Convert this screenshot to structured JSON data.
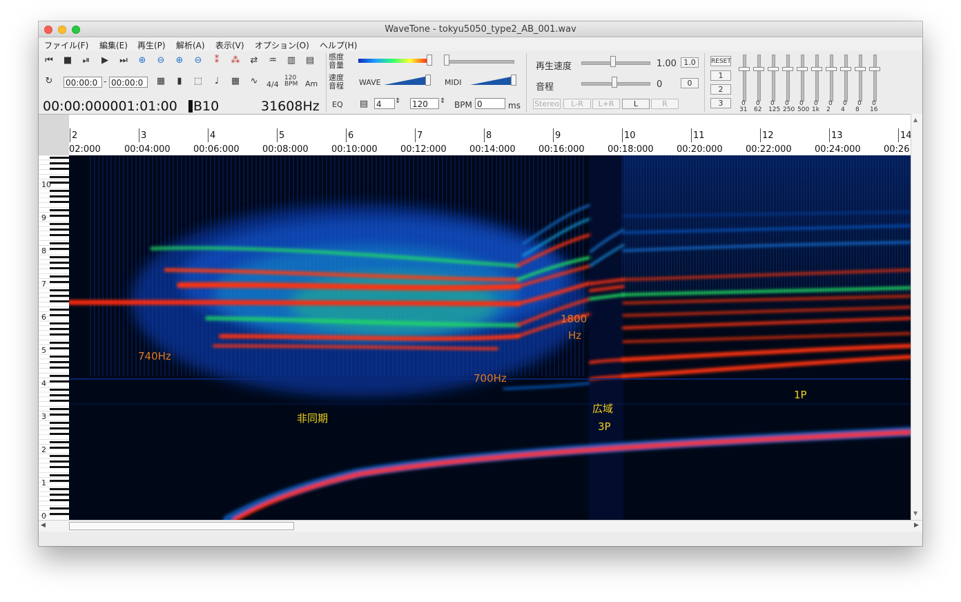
{
  "window": {
    "title": "WaveTone - tokyu5050_type2_AB_001.wav"
  },
  "menu": [
    "ファイル(F)",
    "編集(E)",
    "再生(P)",
    "解析(A)",
    "表示(V)",
    "オプション(O)",
    "ヘルプ(H)"
  ],
  "toolbar": {
    "sensitivity_volume": "感度\n音量",
    "speed_pitch": "速度\n音程",
    "eq": "EQ",
    "range_start": "00:00:0",
    "range_end": "00:00:0",
    "time_sig": "4/4",
    "tempo_small": "120\nBPM",
    "key_small": "Am",
    "wave_label": "WAVE",
    "midi_label": "MIDI",
    "beats_value": "4",
    "bpm_value": "120",
    "bpm_label": "BPM",
    "ms_value": "0",
    "ms_label": "ms",
    "position_readout": "00:00:000001:01:00",
    "note_readout": "B10",
    "freq_readout": "31608Hz",
    "speed_label": "再生速度",
    "speed_value": "1.00",
    "speed_reset": "1.0",
    "pitch_label": "音程",
    "pitch_value": "0",
    "pitch_reset": "0",
    "stereo": "Stereo",
    "l_minus_r": "L-R",
    "l_plus_r": "L+R",
    "l": "L",
    "r": "R",
    "eq_reset": "RESET",
    "eq_presets": [
      "1",
      "2",
      "3"
    ],
    "eq_bands": [
      "31",
      "62",
      "125",
      "250",
      "500",
      "1k",
      "2",
      "4",
      "8",
      "16"
    ]
  },
  "ruler": {
    "measures": [
      "2",
      "3",
      "4",
      "5",
      "6",
      "7",
      "8",
      "9",
      "10",
      "11",
      "12",
      "13",
      "14"
    ],
    "times": [
      "02:000",
      "00:04:000",
      "00:06:000",
      "00:08:000",
      "00:10:000",
      "00:12:000",
      "00:14:000",
      "00:16:000",
      "00:18:000",
      "00:20:000",
      "00:22:000",
      "00:24:000",
      "00:26:"
    ]
  },
  "piano_octaves": [
    "10",
    "9",
    "8",
    "7",
    "6",
    "5",
    "4",
    "3",
    "2",
    "1",
    "0"
  ],
  "annotations": {
    "a740": "740Hz",
    "a700": "700Hz",
    "a1800": "1800",
    "a1800hz": "Hz",
    "async": "非同期",
    "wide": "広域",
    "wide3p": "3P",
    "p1": "1P"
  },
  "colors": {
    "background": "#000818",
    "hot": "#ff3010",
    "mid": "#20ff60",
    "cool": "#0a40d0",
    "annot_orange": "#e07a22",
    "annot_yellow": "#f0d21a"
  }
}
